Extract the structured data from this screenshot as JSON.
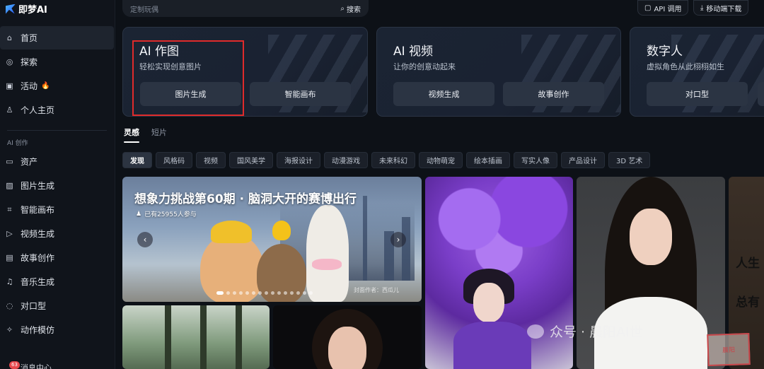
{
  "app": {
    "logo_text": "即梦AI"
  },
  "sidebar": {
    "primary": [
      {
        "label": "首页",
        "icon": "home-icon"
      },
      {
        "label": "探索",
        "icon": "compass-icon"
      },
      {
        "label": "活动",
        "icon": "gift-icon",
        "emoji": "🔥"
      },
      {
        "label": "个人主页",
        "icon": "user-icon"
      }
    ],
    "section_label": "AI 创作",
    "creation": [
      {
        "label": "资产",
        "icon": "folder-icon"
      },
      {
        "label": "图片生成",
        "icon": "image-icon"
      },
      {
        "label": "智能画布",
        "icon": "canvas-icon"
      },
      {
        "label": "视频生成",
        "icon": "video-icon"
      },
      {
        "label": "故事创作",
        "icon": "story-icon"
      },
      {
        "label": "音乐生成",
        "icon": "music-icon"
      },
      {
        "label": "对口型",
        "icon": "lip-sync-icon"
      },
      {
        "label": "动作模仿",
        "icon": "motion-icon"
      }
    ],
    "message_badge": "63",
    "message_label": "消息中心"
  },
  "topbar": {
    "search_placeholder": "定制玩偶",
    "search_button": "搜索",
    "api_button": "API 调用",
    "download_button": "移动端下载"
  },
  "cards": [
    {
      "title": "AI 作图",
      "subtitle": "轻松实现创意图片",
      "buttons": [
        "图片生成",
        "智能画布"
      ]
    },
    {
      "title": "AI 视频",
      "subtitle": "让你的创意动起来",
      "buttons": [
        "视频生成",
        "故事创作"
      ]
    },
    {
      "title": "数字人",
      "subtitle": "虚拟角色从此栩栩如生",
      "buttons": [
        "对口型",
        ""
      ]
    }
  ],
  "tabs": [
    "灵感",
    "短片"
  ],
  "chips": [
    "发现",
    "风格码",
    "视频",
    "国风美学",
    "海报设计",
    "动漫游戏",
    "未来科幻",
    "动物萌宠",
    "绘本插画",
    "写实人像",
    "产品设计",
    "3D 艺术"
  ],
  "banner": {
    "title": "想象力挑战第60期 · 脑洞大开的赛博出行",
    "participants": "已有25955人参与",
    "credit": "封面作者：西瓜儿"
  },
  "right_tile_text": [
    "人生",
    "总有"
  ],
  "watermark": {
    "text": "众号 · 晨阳AI世",
    "seal": "晨阳"
  },
  "colors": {
    "highlight": "#e02b2b",
    "accent": "#2a5bff",
    "badge": "#e5484d"
  }
}
